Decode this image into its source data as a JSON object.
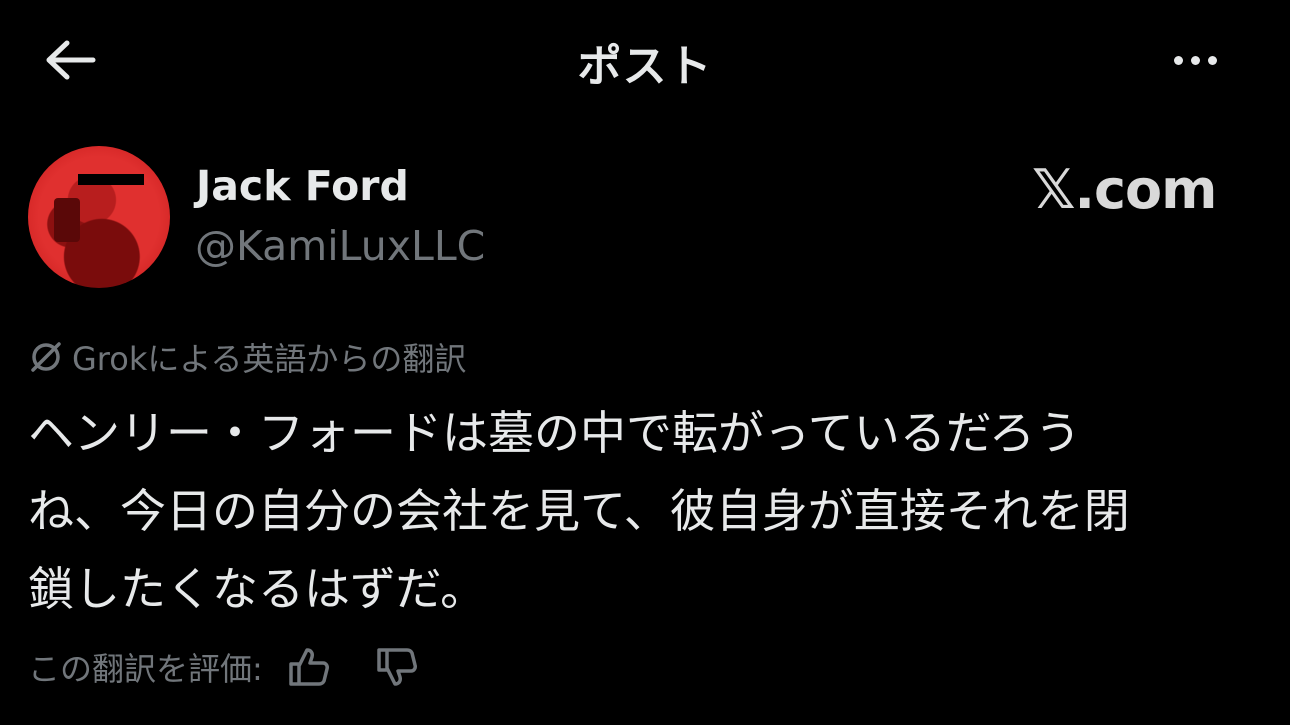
{
  "header": {
    "title": "ポスト",
    "back_icon": "arrow-left-icon",
    "more_icon": "more-horizontal-icon"
  },
  "author": {
    "name": "Jack Ford",
    "handle": "@KamiLuxLLC",
    "avatar_icon": "avatar-image"
  },
  "watermark": "𝕏.com",
  "translation": {
    "icon": "grok-icon",
    "label": "Grokによる英語からの翻訳"
  },
  "post": {
    "lines": [
      "ヘンリー・フォードは墓の中で転がっているだろう",
      "ね、今日の自分の会社を見て、彼自身が直接それを閉",
      "鎖したくなるはずだ。"
    ]
  },
  "rating": {
    "label": "この翻訳を評価:",
    "thumbs_up_icon": "thumbs-up-icon",
    "thumbs_down_icon": "thumbs-down-icon"
  },
  "colors": {
    "background": "#000000",
    "text_primary": "#e7e9ea",
    "text_secondary": "#71767b",
    "avatar_red": "#e0302f"
  }
}
